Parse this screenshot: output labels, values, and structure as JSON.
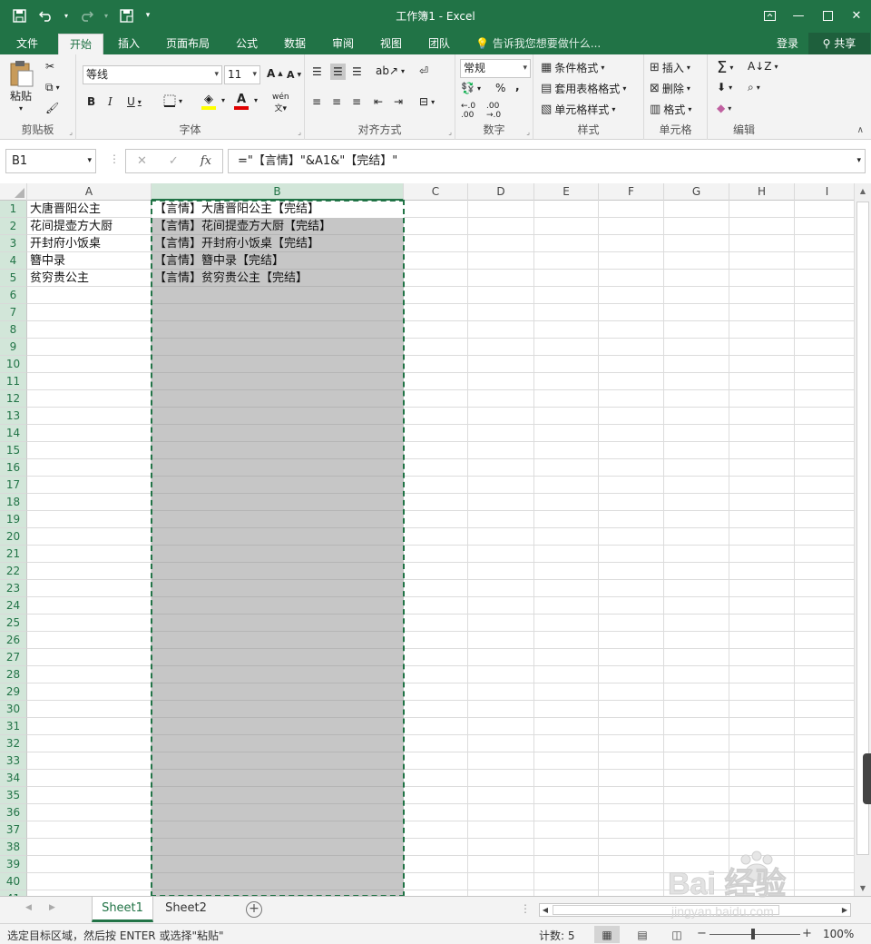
{
  "window": {
    "title": "工作簿1 - Excel",
    "qat": {
      "save_icon": "save-icon",
      "undo_icon": "undo-icon",
      "redo_icon": "redo-icon",
      "print_preview_icon": "print-preview-icon",
      "more": "▾"
    }
  },
  "tabs": [
    "文件",
    "开始",
    "插入",
    "页面布局",
    "公式",
    "数据",
    "审阅",
    "视图",
    "团队"
  ],
  "active_tab": "开始",
  "tell_me": "告诉我您想要做什么...",
  "login": "登录",
  "share": "共享",
  "ribbon": {
    "clipboard": {
      "label": "剪贴板",
      "paste": "粘贴"
    },
    "font": {
      "label": "字体",
      "font_name": "等线",
      "font_size": "11",
      "bold": "B",
      "italic": "I",
      "underline": "U",
      "grow": "A",
      "shrink": "A",
      "phonetic": "wén"
    },
    "alignment": {
      "label": "对齐方式"
    },
    "number": {
      "label": "数字",
      "format": "常规",
      "percent": "%",
      "comma": ","
    },
    "styles": {
      "label": "样式",
      "conditional": "条件格式",
      "table": "套用表格格式",
      "cell_styles": "单元格样式"
    },
    "cells": {
      "label": "单元格",
      "insert": "插入",
      "delete": "删除",
      "format": "格式"
    },
    "editing": {
      "label": "编辑"
    }
  },
  "formula_bar": {
    "name_box": "B1",
    "cancel": "✕",
    "enter": "✓",
    "fx": "fx",
    "formula": "=\"【言情】\"&A1&\"【完结】\""
  },
  "columns": [
    "A",
    "B",
    "C",
    "D",
    "E",
    "F",
    "G",
    "H",
    "I"
  ],
  "selected_column": "B",
  "rows": [
    1,
    2,
    3,
    4,
    5,
    6,
    7,
    8,
    9,
    10,
    11,
    12,
    13,
    14,
    15,
    16,
    17,
    18,
    19,
    20,
    21,
    22,
    23,
    24,
    25,
    26,
    27,
    28,
    29,
    30,
    31,
    32,
    33,
    34,
    35,
    36,
    37,
    38,
    39,
    40,
    41
  ],
  "colA": [
    "大唐晋阳公主",
    "花间提壶方大厨",
    "开封府小饭桌",
    "簪中录",
    "贫穷贵公主"
  ],
  "colB": [
    "【言情】大唐晋阳公主【完结】",
    "【言情】花间提壶方大厨【完结】",
    "【言情】开封府小饭桌【完结】",
    "【言情】簪中录【完结】",
    "【言情】贫穷贵公主【完结】"
  ],
  "sheets": [
    "Sheet1",
    "Sheet2"
  ],
  "active_sheet": "Sheet1",
  "status": {
    "message": "选定目标区域，然后按 ENTER 或选择\"粘贴\"",
    "count": "计数: 5",
    "zoom": "100%"
  },
  "watermark": {
    "brand": "Bai 经验",
    "url": "jingyan.baidu.com"
  },
  "colors": {
    "accent": "#217346",
    "selection": "#c6c6c6"
  }
}
